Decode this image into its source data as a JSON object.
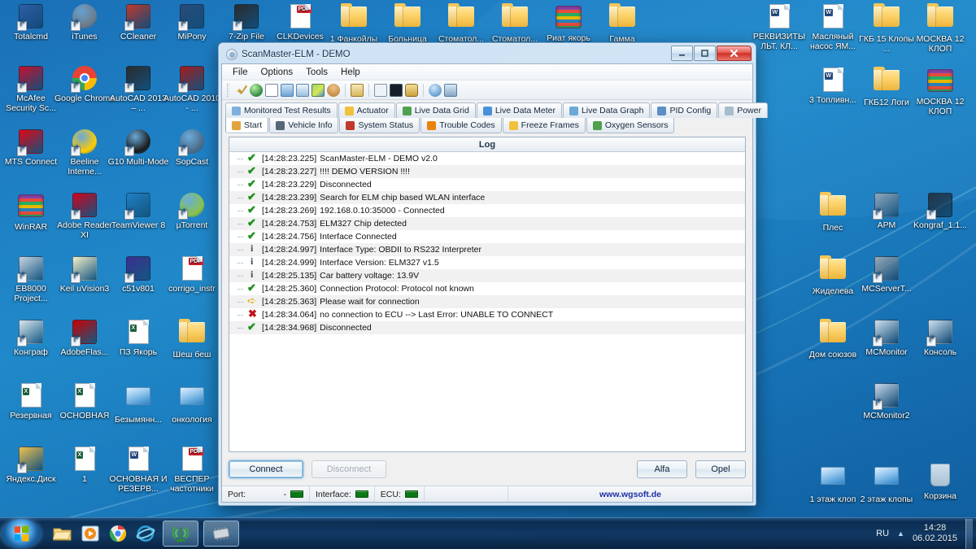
{
  "desktop": {
    "icons_col1": [
      {
        "label": "Totalcmd",
        "type": "app",
        "color": "#2f5fa8"
      },
      {
        "label": "McAfee Security Sc...",
        "type": "app",
        "color": "#c8102e"
      },
      {
        "label": "MTS Connect",
        "type": "app",
        "color": "#e30613"
      },
      {
        "label": "WinRAR",
        "type": "rar"
      },
      {
        "label": "EB8000 Project...",
        "type": "app",
        "color": "#c8d4e0"
      },
      {
        "label": "Конграф",
        "type": "app",
        "color": "#dbe6f0"
      },
      {
        "label": "Резервная",
        "type": "excel"
      },
      {
        "label": "Яндекс.Диск",
        "type": "app",
        "color": "#f2c14e"
      }
    ],
    "icons_col2": [
      {
        "label": "iTunes",
        "type": "round",
        "color": "#6d7b8a"
      },
      {
        "label": "Google Chrome",
        "type": "chrome"
      },
      {
        "label": "Beeline Interne...",
        "type": "round",
        "color": "#ffcc00"
      },
      {
        "label": "Adobe Reader XI",
        "type": "app",
        "color": "#d0021b"
      },
      {
        "label": "Keil uVision3",
        "type": "app",
        "color": "#f5f0c8"
      },
      {
        "label": "AdobeFlas...",
        "type": "app",
        "color": "#cc0000"
      },
      {
        "label": "ОСНОВНАЯ",
        "type": "excel"
      },
      {
        "label": "1",
        "type": "excel"
      }
    ],
    "icons_col3": [
      {
        "label": "CCleaner",
        "type": "app",
        "color": "#c0392b"
      },
      {
        "label": "AutoCAD 2013 – ...",
        "type": "app",
        "color": "#2b2b2b"
      },
      {
        "label": "G10 Multi-Mode",
        "type": "round",
        "color": "#1b1b1b"
      },
      {
        "label": "TeamViewer 8",
        "type": "app",
        "color": "#1f7fc4"
      },
      {
        "label": "c51v801",
        "type": "app",
        "color": "#3b2f8f"
      },
      {
        "label": "ПЗ Якорь",
        "type": "excel"
      },
      {
        "label": "Безымянн...",
        "type": "monitor"
      },
      {
        "label": "ОСНОВНАЯ И РЕЗЕРВ...",
        "type": "word"
      }
    ],
    "icons_col4": [
      {
        "label": "MiPony",
        "type": "app",
        "color": "#2a4c7a"
      },
      {
        "label": "AutoCAD 2010 - ...",
        "type": "app",
        "color": "#a61c1c"
      },
      {
        "label": "SopCast",
        "type": "round",
        "color": "#4d6b8a"
      },
      {
        "label": "µTorrent",
        "type": "round",
        "color": "#8bc34a"
      },
      {
        "label": "corrigo_instr",
        "type": "pdf"
      },
      {
        "label": "Шеш беш",
        "type": "folder"
      },
      {
        "label": "онкология",
        "type": "monitor"
      },
      {
        "label": "ВЕСПЕР частотники",
        "type": "pdf"
      }
    ],
    "icons_top_mid": [
      {
        "label": "7-Zip File",
        "type": "app",
        "color": "#2b2b2b"
      },
      {
        "label": "CLKDevices",
        "type": "pdf"
      },
      {
        "label": "1 Фанкойлы",
        "type": "folder"
      },
      {
        "label": "Больница",
        "type": "folder"
      },
      {
        "label": "Стоматол...",
        "type": "folder"
      },
      {
        "label": "Стоматол...",
        "type": "folder"
      },
      {
        "label": "Риат якорь",
        "type": "rar"
      },
      {
        "label": "Гамма",
        "type": "folder"
      }
    ],
    "icons_right": [
      {
        "label": "РЕКВИЗИТЫ ЛЬТ. КЛ...",
        "type": "word"
      },
      {
        "label": "Масляный насос ЯМ...",
        "type": "word"
      },
      {
        "label": "ГКБ 15 Клопы ...",
        "type": "folder"
      },
      {
        "label": "МОСКВА 12 КЛОП",
        "type": "folder"
      },
      {
        "label": "3 Топливн...",
        "type": "word"
      },
      {
        "label": "ГКБ12 Логи",
        "type": "folder"
      },
      {
        "label": "МОСКВА 12 КЛОП",
        "type": "rar"
      },
      {
        "label": "Плес",
        "type": "folder"
      },
      {
        "label": "АРМ",
        "type": "app",
        "color": "#8fa8bd"
      },
      {
        "label": "Kongraf_1.1...",
        "type": "app",
        "color": "#243447"
      },
      {
        "label": "Жиделева",
        "type": "folder"
      },
      {
        "label": "MCServerT...",
        "type": "app",
        "color": "#9aaabb"
      },
      {
        "label": "Дом союзов",
        "type": "folder"
      },
      {
        "label": "MCMonitor",
        "type": "app",
        "color": "#cfe0ef"
      },
      {
        "label": "Консоль",
        "type": "app",
        "color": "#cfe0ef"
      },
      {
        "label": "MCMonitor2",
        "type": "app",
        "color": "#c9d9ea"
      },
      {
        "label": "1 этаж клоп",
        "type": "monitor"
      },
      {
        "label": "2 этаж клопы",
        "type": "monitor"
      },
      {
        "label": "Корзина",
        "type": "bin"
      }
    ]
  },
  "window": {
    "title": "ScanMaster-ELM - DEMO",
    "icon": "scanner-icon",
    "buttons": {
      "connect": "Connect",
      "disconnect": "Disconnect",
      "alfa": "Alfa",
      "opel": "Opel"
    },
    "menu": [
      "File",
      "Options",
      "Tools",
      "Help"
    ],
    "toolbar_icons": [
      "connect-icon",
      "globe-icon",
      "report-icon",
      "grid-icon",
      "chart-icon",
      "image-icon",
      "user-icon",
      "clipboard-icon",
      "terminal-window-icon",
      "console-icon",
      "device-icon",
      "info-icon",
      "exit-icon"
    ],
    "tabs_row1": [
      {
        "label": "Monitored Test Results",
        "icon": "gauge-icon",
        "color": "#7fb0dd",
        "active": false
      },
      {
        "label": "Actuator",
        "icon": "hand-icon",
        "color": "#f2c13c",
        "active": false
      },
      {
        "label": "Live Data Grid",
        "icon": "list-icon",
        "color": "#4fa14f",
        "active": false
      },
      {
        "label": "Live Data Meter",
        "icon": "meter-icon",
        "color": "#4a90d9",
        "active": false
      },
      {
        "label": "Live Data Graph",
        "icon": "bars-icon",
        "color": "#6aa9d8",
        "active": false
      },
      {
        "label": "PID Config",
        "icon": "pid-icon",
        "color": "#5d8fc4",
        "active": false
      },
      {
        "label": "Power",
        "icon": "power-icon",
        "color": "#a7bccc",
        "active": false
      }
    ],
    "tabs_row2": [
      {
        "label": "Start",
        "icon": "home-icon",
        "color": "#e3a33c",
        "active": true
      },
      {
        "label": "Vehicle Info",
        "icon": "info-i-icon",
        "color": "#556677",
        "active": false
      },
      {
        "label": "System Status",
        "icon": "status-icon",
        "color": "#c0392b",
        "active": false
      },
      {
        "label": "Trouble Codes",
        "icon": "warning-icon",
        "color": "#e8830c",
        "active": false
      },
      {
        "label": "Freeze Frames",
        "icon": "hand-icon",
        "color": "#f2c13c",
        "active": false
      },
      {
        "label": "Oxygen Sensors",
        "icon": "o2-icon",
        "color": "#4fa14f",
        "active": false
      }
    ],
    "log": {
      "header": "Log",
      "entries": [
        {
          "severity": "ok",
          "time": "[14:28:23.225]",
          "text": "ScanMaster-ELM - DEMO v2.0"
        },
        {
          "severity": "ok",
          "time": "[14:28:23.227]",
          "text": "!!!! DEMO VERSION !!!!"
        },
        {
          "severity": "ok",
          "time": "[14:28:23.229]",
          "text": "Disconnected"
        },
        {
          "severity": "ok",
          "time": "[14:28:23.239]",
          "text": "Search for ELM chip based WLAN interface"
        },
        {
          "severity": "ok",
          "time": "[14:28:23.269]",
          "text": "192.168.0.10:35000 - Connected"
        },
        {
          "severity": "ok",
          "time": "[14:28:24.753]",
          "text": "ELM327 Chip detected"
        },
        {
          "severity": "ok",
          "time": "[14:28:24.756]",
          "text": "Interface Connected"
        },
        {
          "severity": "info",
          "time": "[14:28:24.997]",
          "text": "Interface Type: OBDII to RS232 Interpreter"
        },
        {
          "severity": "info",
          "time": "[14:28:24.999]",
          "text": "Interface Version: ELM327 v1.5"
        },
        {
          "severity": "info",
          "time": "[14:28:25.135]",
          "text": "Car battery voltage: 13.9V"
        },
        {
          "severity": "ok",
          "time": "[14:28:25.360]",
          "text": "Connection Protocol: Protocol not known"
        },
        {
          "severity": "warn",
          "time": "[14:28:25.363]",
          "text": "Please wait for connection"
        },
        {
          "severity": "error",
          "time": "[14:28:34.064]",
          "text": "no connection to ECU --> Last Error: UNABLE TO CONNECT"
        },
        {
          "severity": "ok",
          "time": "[14:28:34.968]",
          "text": "Disconnected"
        }
      ]
    },
    "statusbar": {
      "port_label": "Port:",
      "port_value": "-",
      "interface_label": "Interface:",
      "ecu_label": "ECU:",
      "website": "www.wgsoft.de",
      "led_color": "#0a7a14"
    }
  },
  "taskbar": {
    "start_tooltip": "Start",
    "quick_launch": [
      "explorer-icon",
      "media-player-icon",
      "chrome-icon",
      "internet-explorer-icon"
    ],
    "task_items": [
      "wifi-antenna-icon",
      "chip-icon"
    ],
    "tray": {
      "language": "RU",
      "arrow": "▲",
      "time": "14:28",
      "date": "06.02.2015"
    }
  }
}
